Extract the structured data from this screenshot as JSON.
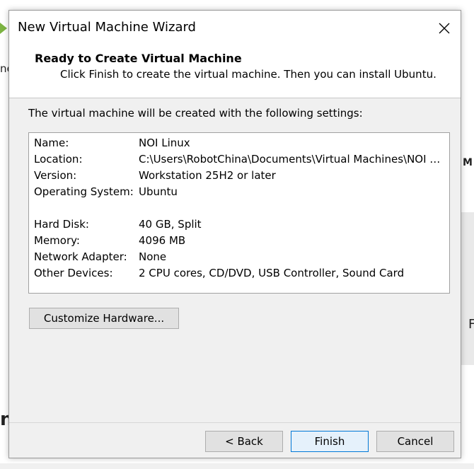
{
  "background": {
    "left_fragment": "ne",
    "right_fragment_top": "M",
    "right_fragment_mid": "F",
    "left_fragment_bottom": "n"
  },
  "dialog": {
    "title": "New Virtual Machine Wizard",
    "header": {
      "title": "Ready to Create Virtual Machine",
      "subtitle": "Click Finish to create the virtual machine. Then you can install Ubuntu."
    },
    "intro": "The virtual machine will be created with the following settings:",
    "settings": [
      {
        "label": "Name:",
        "value": "NOI Linux"
      },
      {
        "label": "Location:",
        "value": "C:\\Users\\RobotChina\\Documents\\Virtual Machines\\NOI Lin..."
      },
      {
        "label": "Version:",
        "value": "Workstation 25H2 or later"
      },
      {
        "label": "Operating System:",
        "value": "Ubuntu"
      },
      {
        "label": "Hard Disk:",
        "value": "40 GB, Split"
      },
      {
        "label": "Memory:",
        "value": "4096 MB"
      },
      {
        "label": "Network Adapter:",
        "value": "None"
      },
      {
        "label": "Other Devices:",
        "value": "2 CPU cores, CD/DVD, USB Controller, Sound Card"
      }
    ],
    "buttons": {
      "customize": "Customize Hardware...",
      "back": "< Back",
      "finish": "Finish",
      "cancel": "Cancel"
    }
  },
  "colors": {
    "accent": "#0078d7",
    "dialog_bg": "#f0f0f0",
    "header_bg": "#ffffff"
  },
  "icons": {
    "close": "close-icon"
  }
}
